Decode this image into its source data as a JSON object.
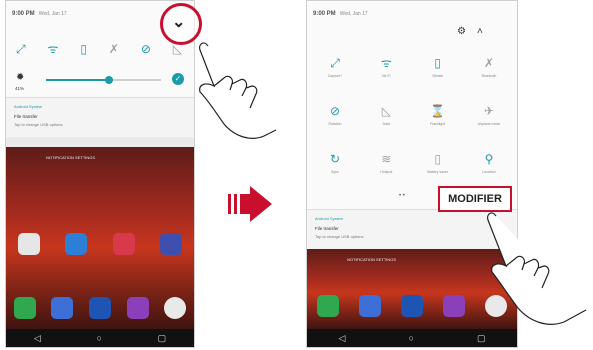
{
  "left_screen": {
    "status_time": "9:00 PM",
    "status_date": "Wed, Jan 17",
    "brightness_percent": "41%",
    "brightness_level": 0.55,
    "quick_icons": [
      "rotate-icon",
      "wifi-icon",
      "vibrate-icon",
      "bluetooth-off-icon",
      "do-not-disturb-icon",
      "data-icon"
    ],
    "notification": {
      "source": "Android System",
      "title": "File transfer",
      "text": "Tap to change USB options"
    },
    "wallpaper_text": "NOTIFICATION SETTINGS"
  },
  "right_screen": {
    "status_time": "9:00 PM",
    "status_date": "Wed, Jan 17",
    "tiles": [
      {
        "icon": "rotate-icon",
        "label": "Capture+",
        "active": true
      },
      {
        "icon": "wifi-icon",
        "label": "Wi-Fi",
        "active": true
      },
      {
        "icon": "vibrate-icon",
        "label": "Vibrate",
        "active": true
      },
      {
        "icon": "bluetooth-icon",
        "label": "Bluetooth",
        "active": false
      },
      {
        "icon": "do-not-disturb-icon",
        "label": "Rotation",
        "active": true
      },
      {
        "icon": "data-icon",
        "label": "Data",
        "active": false
      },
      {
        "icon": "flashlight-icon",
        "label": "Flashlight",
        "active": false
      },
      {
        "icon": "airplane-icon",
        "label": "Airplane mode",
        "active": false
      },
      {
        "icon": "sync-icon",
        "label": "Sync",
        "active": true
      },
      {
        "icon": "hotspot-icon",
        "label": "Hotspot",
        "active": false
      },
      {
        "icon": "battery-saver-icon",
        "label": "Battery saver",
        "active": false
      },
      {
        "icon": "location-icon",
        "label": "Location",
        "active": true
      }
    ],
    "page_indicator": "• •",
    "modifier_label": "MODIFIER",
    "notification": {
      "source": "Android System",
      "title": "File transfer",
      "text": "Tap to change USB options"
    },
    "wallpaper_text": "NOTIFICATION SETTINGS"
  },
  "colors": {
    "accent": "#1b9aa8",
    "highlight": "#c8102e",
    "arrow": "#c8102e"
  }
}
